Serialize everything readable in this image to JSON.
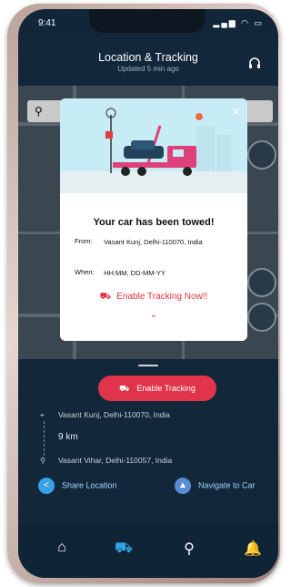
{
  "status": {
    "time": "9:41",
    "icons": "▂▄▆ ◠ ▭"
  },
  "header": {
    "title": "Location & Tracking",
    "subtitle": "Updated 5 min ago",
    "support_icon": "headset-icon"
  },
  "modal": {
    "close": "×",
    "heading": "Your car has been towed!",
    "from_label": "From:",
    "from_value": "Vasant Kunj, Delhi-110070, India",
    "when_label": "When:",
    "when_value": "HH:MM, DD-MM-YY",
    "cta_label": "Enable Tracking Now!!",
    "chevron": "⌄"
  },
  "sheet": {
    "track_button": "Enable Tracking",
    "from_address": "Vasant Kunj, Delhi-110070, India",
    "distance": "9 km",
    "to_address": "Vasant Vihar, Delhi-110057, India",
    "share_label": "Share Location",
    "navigate_label": "Navigate to Car"
  },
  "tabs": [
    {
      "icon": "home-icon",
      "glyph": "⌂"
    },
    {
      "icon": "car-tracking-icon",
      "glyph": "⛟"
    },
    {
      "icon": "route-icon",
      "glyph": "⚲"
    },
    {
      "icon": "bell-icon",
      "glyph": "🔔"
    }
  ],
  "colors": {
    "accent": "#e0344a",
    "dark_bg": "#13273a",
    "tab_active": "#2ea3e6"
  }
}
